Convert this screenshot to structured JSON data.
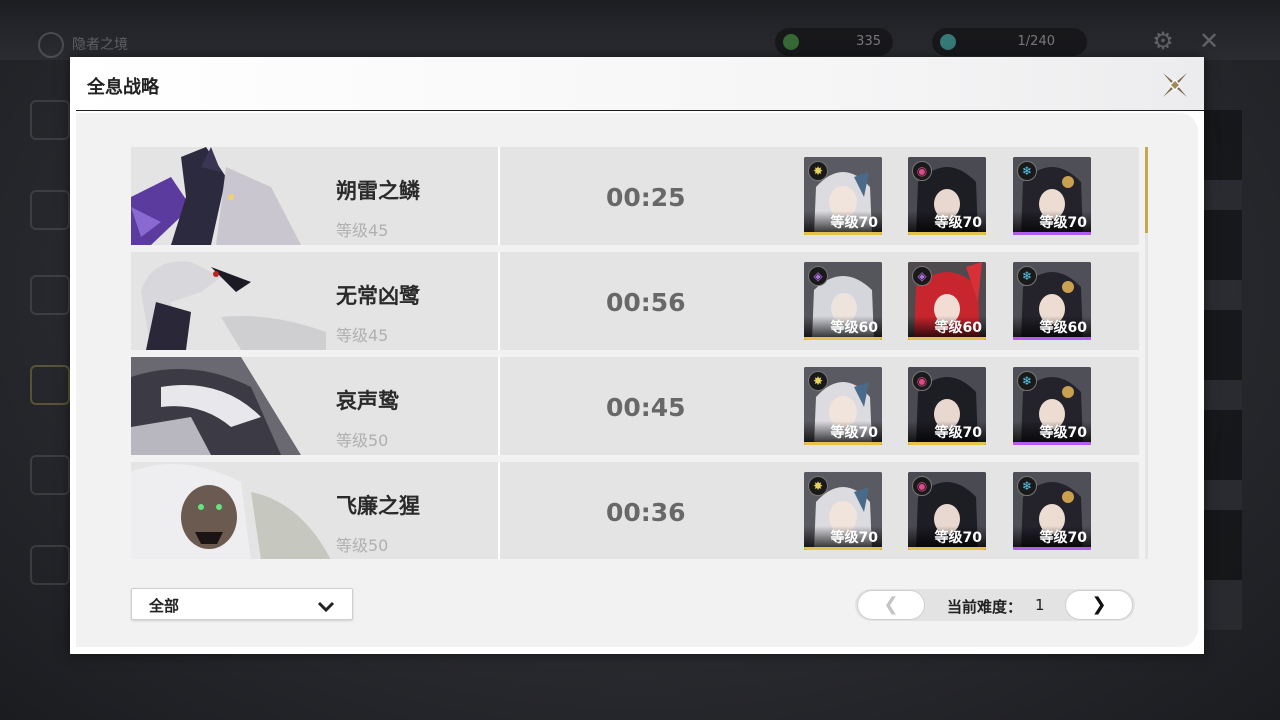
{
  "background": {
    "title": "隐者之境",
    "currency_a": "335",
    "currency_b": "1/240"
  },
  "modal": {
    "title": "全息战略"
  },
  "bosses": [
    {
      "name": "朔雷之鳞",
      "level": "等级45",
      "time": "00:25",
      "team": [
        {
          "element": "spectro",
          "level": "等级70",
          "rarity_color": "#e7c24a"
        },
        {
          "element": "fusion-havoc",
          "level": "等级70",
          "rarity_color": "#e7c24a"
        },
        {
          "element": "glacio",
          "level": "等级70",
          "rarity_color": "#b35cf0"
        }
      ]
    },
    {
      "name": "无常凶鹭",
      "level": "等级45",
      "time": "00:56",
      "team": [
        {
          "element": "havoc",
          "level": "等级60",
          "rarity_color": "#e7c24a"
        },
        {
          "element": "havoc",
          "level": "等级60",
          "rarity_color": "#e7c24a"
        },
        {
          "element": "glacio",
          "level": "等级60",
          "rarity_color": "#b35cf0"
        }
      ]
    },
    {
      "name": "哀声鸷",
      "level": "等级50",
      "time": "00:45",
      "team": [
        {
          "element": "spectro",
          "level": "等级70",
          "rarity_color": "#e7c24a"
        },
        {
          "element": "fusion-havoc",
          "level": "等级70",
          "rarity_color": "#e7c24a"
        },
        {
          "element": "glacio",
          "level": "等级70",
          "rarity_color": "#b35cf0"
        }
      ]
    },
    {
      "name": "飞廉之猩",
      "level": "等级50",
      "time": "00:36",
      "team": [
        {
          "element": "spectro",
          "level": "等级70",
          "rarity_color": "#e7c24a"
        },
        {
          "element": "fusion-havoc",
          "level": "等级70",
          "rarity_color": "#e7c24a"
        },
        {
          "element": "glacio",
          "level": "等级70",
          "rarity_color": "#b35cf0"
        }
      ]
    }
  ],
  "footer": {
    "filter_label": "全部",
    "difficulty_label": "当前难度：",
    "difficulty_value": "1",
    "prev_symbol": "❮",
    "next_symbol": "❯"
  },
  "colors": {
    "accent_gold": "#c9a64a",
    "rarity_5": "#e7c24a",
    "rarity_4": "#b35cf0"
  }
}
